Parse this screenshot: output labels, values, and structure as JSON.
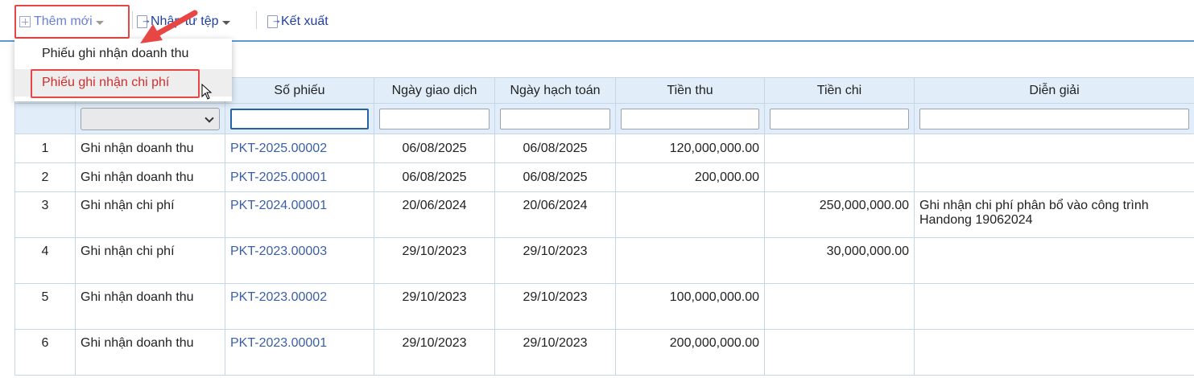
{
  "toolbar": {
    "add_label": "Thêm mới",
    "import_label": "Nhập từ tệp",
    "export_label": "Kết xuất"
  },
  "add_menu": {
    "items": [
      "Phiếu ghi nhận doanh thu",
      "Phiếu ghi nhận chi phí"
    ],
    "highlighted_index": 1
  },
  "table": {
    "columns": [
      "",
      "",
      "Số phiếu",
      "Ngày giao dịch",
      "Ngày hạch toán",
      "Tiền thu",
      "Tiền chi",
      "Diễn giải"
    ],
    "rows": [
      [
        "1",
        "Ghi nhận doanh thu",
        "PKT-2025.00002",
        "06/08/2025",
        "06/08/2025",
        "120,000,000.00",
        "",
        ""
      ],
      [
        "2",
        "Ghi nhận doanh thu",
        "PKT-2025.00001",
        "06/08/2025",
        "06/08/2025",
        "200,000.00",
        "",
        ""
      ],
      [
        "3",
        "Ghi nhận chi phí",
        "PKT-2024.00001",
        "20/06/2024",
        "20/06/2024",
        "",
        "250,000,000.00",
        "Ghi nhận chi phí phân bổ vào công trình Handong 19062024"
      ],
      [
        "4",
        "Ghi nhận chi phí",
        "PKT-2023.00003",
        "29/10/2023",
        "29/10/2023",
        "",
        "30,000,000.00",
        ""
      ],
      [
        "5",
        "Ghi nhận doanh thu",
        "PKT-2023.00002",
        "29/10/2023",
        "29/10/2023",
        "100,000,000.00",
        "",
        ""
      ],
      [
        "6",
        "Ghi nhận doanh thu",
        "PKT-2023.00001",
        "29/10/2023",
        "29/10/2023",
        "200,000,000.00",
        "",
        ""
      ]
    ]
  },
  "colors": {
    "header_bg": "#e1edf8",
    "link": "#3a5fa8",
    "highlight": "#e84545",
    "toolbar_text": "#1f3fa3"
  },
  "icons": [
    "plus-square-icon",
    "import-file-icon",
    "export-file-icon",
    "caret-down-icon",
    "chevron-down-icon",
    "mouse-cursor-icon",
    "annotation-arrow-icon"
  ]
}
